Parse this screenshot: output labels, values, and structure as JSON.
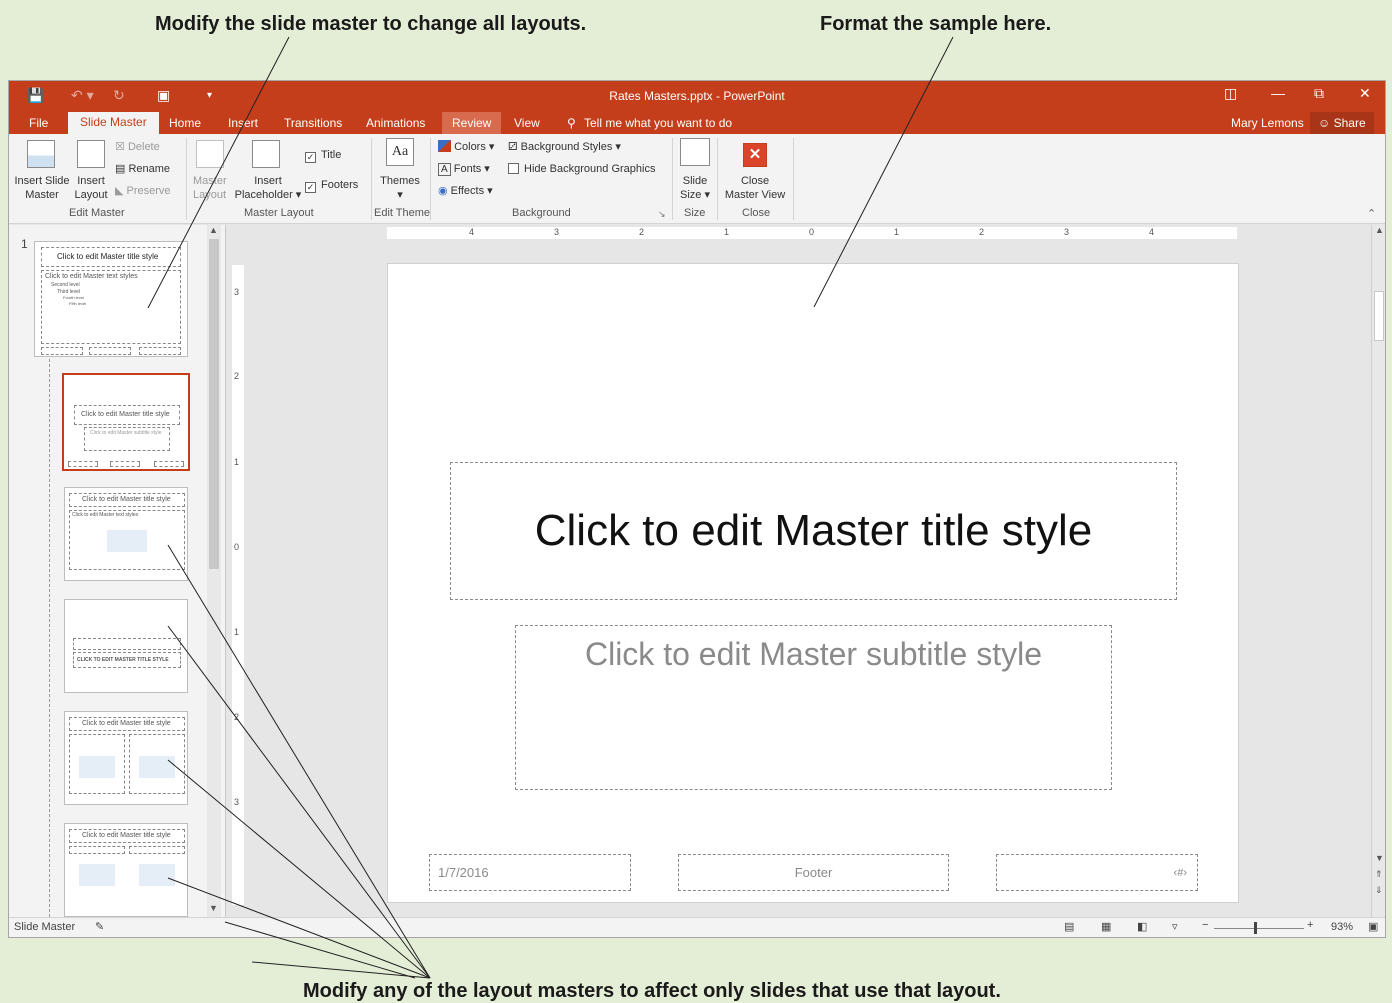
{
  "callouts": {
    "slide_master": "Modify the slide master to change all layouts.",
    "format_sample": "Format the sample here.",
    "layout_masters": "Modify any of the layout masters to affect only slides that use that layout."
  },
  "titlebar": {
    "title": "Rates Masters.pptx - PowerPoint",
    "accent": "#c43e1c"
  },
  "tabs": [
    "File",
    "Slide Master",
    "Home",
    "Insert",
    "Transitions",
    "Animations",
    "Review",
    "View"
  ],
  "tell_me": "Tell me what you want to do",
  "user": "Mary Lemons",
  "share": "Share",
  "ribbon": {
    "edit_master": {
      "insert_slide_master": [
        "Insert Slide",
        "Master"
      ],
      "insert_layout": [
        "Insert",
        "Layout"
      ],
      "delete": "Delete",
      "rename": "Rename",
      "preserve": "Preserve",
      "label": "Edit Master"
    },
    "master_layout": {
      "master_layout_btn": [
        "Master",
        "Layout"
      ],
      "insert_placeholder": [
        "Insert",
        "Placeholder"
      ],
      "title_chk": "Title",
      "footers_chk": "Footers",
      "label": "Master Layout"
    },
    "edit_theme": {
      "themes": "Themes",
      "label": "Edit Theme"
    },
    "background": {
      "colors": "Colors",
      "fonts": "Fonts",
      "effects": "Effects",
      "background_styles": "Background Styles",
      "hide_bg": "Hide Background Graphics",
      "label": "Background"
    },
    "size": {
      "slide_size": [
        "Slide",
        "Size"
      ],
      "label": "Size"
    },
    "close": {
      "close_master": [
        "Close",
        "Master View"
      ],
      "label": "Close"
    }
  },
  "thumbs": {
    "number": "1",
    "master_title": "Click to edit Master title style",
    "master_text": [
      "Click to edit Master text styles",
      "Second level",
      "Third level",
      "Fourth level",
      "Fifth level"
    ],
    "layout_title": "Click to edit Master title style",
    "layout_sub": "Click to edit Master subtitle style",
    "caps_title": "CLICK TO EDIT MASTER TITLE STYLE",
    "caps_text": "Click to edit Master text styles"
  },
  "ruler": {
    "h_labels": [
      "4",
      "3",
      "2",
      "1",
      "0",
      "1",
      "2",
      "3",
      "4"
    ],
    "v_labels": [
      "3",
      "2",
      "1",
      "0",
      "1",
      "2",
      "3"
    ]
  },
  "slide": {
    "title": "Click to edit Master title style",
    "subtitle": "Click to edit Master subtitle style",
    "date": "1/7/2016",
    "footer": "Footer",
    "number": "‹#›"
  },
  "status": {
    "view": "Slide Master",
    "zoom": "93%"
  }
}
